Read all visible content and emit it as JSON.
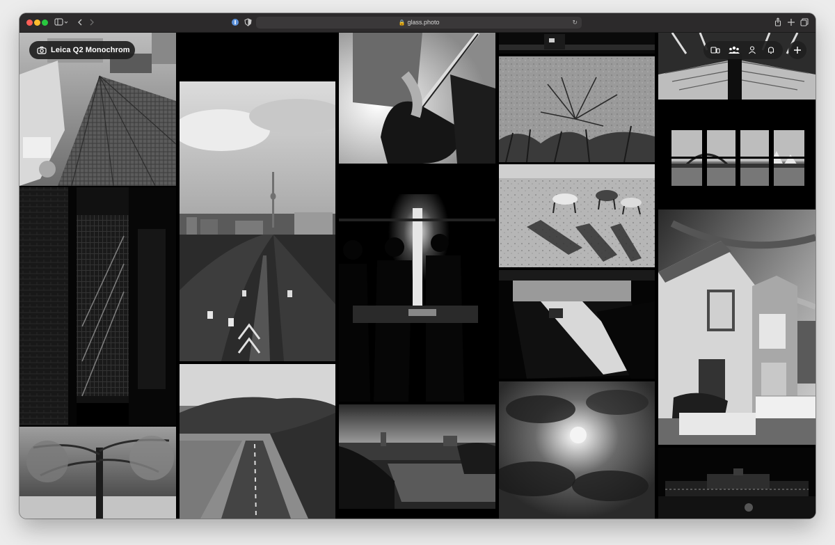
{
  "browser": {
    "url": "glass.photo",
    "icons": [
      "sidebar-icon",
      "back-icon",
      "forward-icon",
      "password-icon",
      "shield-icon",
      "lock-icon",
      "reload-icon",
      "share-icon",
      "new-tab-icon",
      "tabs-icon"
    ]
  },
  "camera_filter": {
    "label": "Leica Q2 Monochrom",
    "icon": "camera-icon"
  },
  "app_nav": {
    "icons": [
      "devices-icon",
      "community-icon",
      "profile-icon",
      "notifications-icon",
      "add-icon"
    ]
  },
  "gallery": {
    "photos": [
      "tower-roof",
      "city-highway",
      "bass-guitarist",
      "dry-plant-sand",
      "ferris-wheel-structure",
      "sydney-harbour-windows",
      "dogs-on-beach",
      "dark-building-facade",
      "bar-silhouettes",
      "underpass-car",
      "suburban-house",
      "bare-tree-park",
      "country-road-hills",
      "river-town-sunset",
      "moon-clouds",
      "night-palace"
    ]
  }
}
